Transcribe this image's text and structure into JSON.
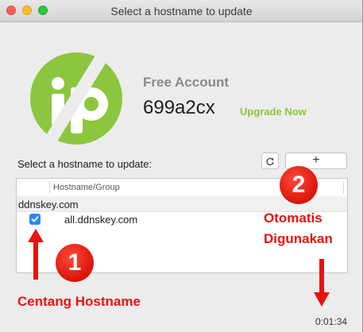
{
  "window": {
    "title": "Select a hostname to update"
  },
  "account": {
    "type": "Free Account",
    "id": "699a2cx",
    "upgrade_label": "Upgrade Now"
  },
  "hostnames": {
    "section_label": "Select a hostname to update:",
    "add_label": "+",
    "column_header": "Hostname/Group",
    "group": "ddnskey.com",
    "items": [
      {
        "hostname": "all.ddnskey.com",
        "checked": true
      }
    ]
  },
  "annotations": {
    "badge_1": "1",
    "badge_2": "2",
    "label_1": "Centang Hostname",
    "label_2_line1": "Otomatis",
    "label_2_line2": "Digunakan"
  },
  "status": {
    "timer": "0:01:34"
  },
  "colors": {
    "brand_green": "#8cc63f",
    "annotation_red": "#e8120f",
    "checkbox_blue": "#2d86f5"
  }
}
